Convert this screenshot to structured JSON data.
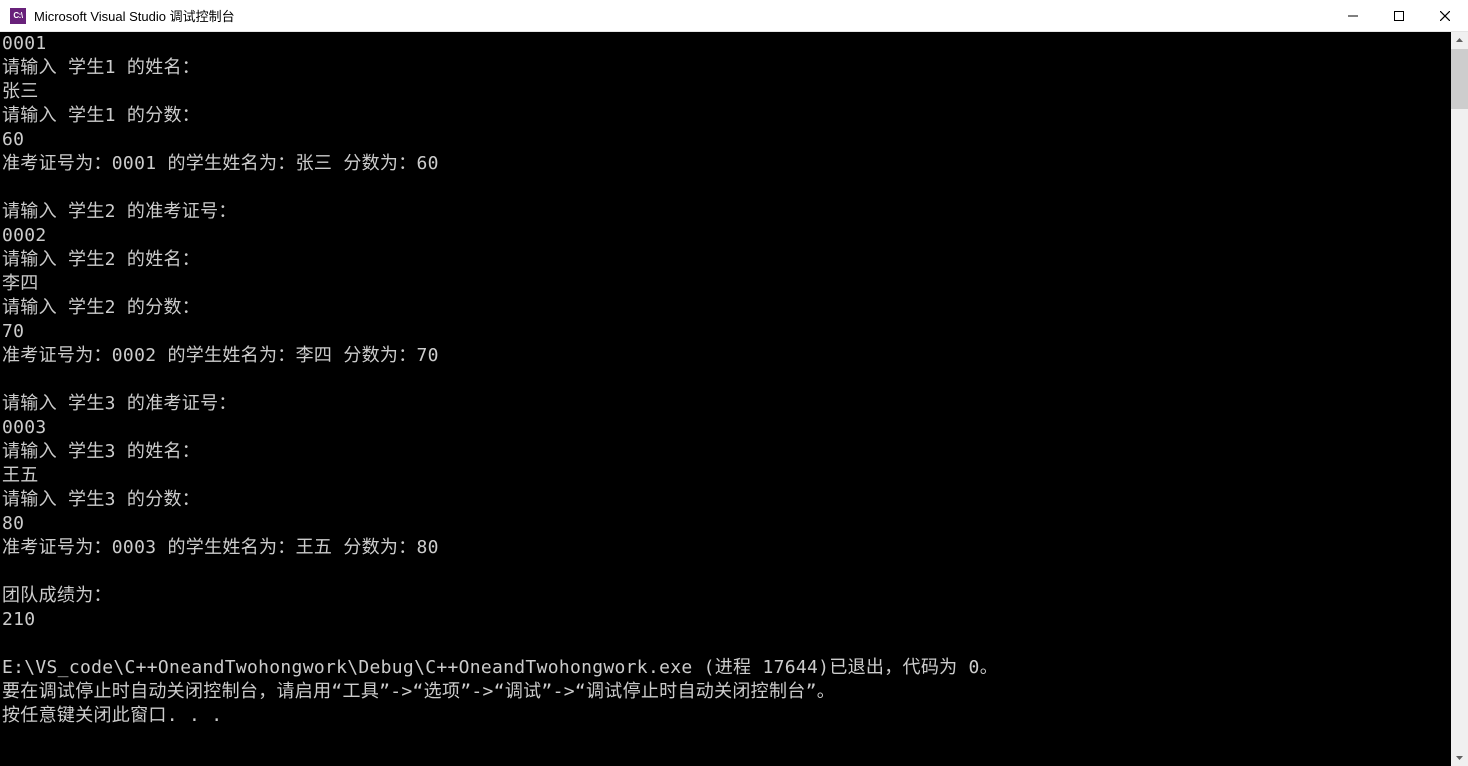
{
  "window": {
    "icon_text": "C:\\",
    "title": "Microsoft Visual Studio 调试控制台"
  },
  "console_lines": [
    "0001",
    "请输入 学生1 的姓名：",
    "张三",
    "请输入 学生1 的分数：",
    "60",
    "准考证号为：0001 的学生姓名为：张三 分数为：60",
    "",
    "请输入 学生2 的准考证号：",
    "0002",
    "请输入 学生2 的姓名：",
    "李四",
    "请输入 学生2 的分数：",
    "70",
    "准考证号为：0002 的学生姓名为：李四 分数为：70",
    "",
    "请输入 学生3 的准考证号：",
    "0003",
    "请输入 学生3 的姓名：",
    "王五",
    "请输入 学生3 的分数：",
    "80",
    "准考证号为：0003 的学生姓名为：王五 分数为：80",
    "",
    "团队成绩为：",
    "210",
    "",
    "E:\\VS_code\\C++OneandTwohongwork\\Debug\\C++OneandTwohongwork.exe (进程 17644)已退出，代码为 0。",
    "要在调试停止时自动关闭控制台，请启用“工具”->“选项”->“调试”->“调试停止时自动关闭控制台”。",
    "按任意键关闭此窗口. . ."
  ]
}
